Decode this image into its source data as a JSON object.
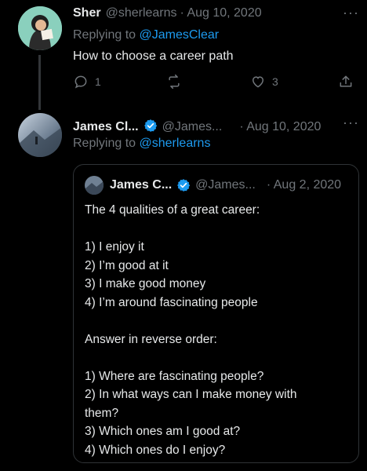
{
  "tweet1": {
    "name": "Sher",
    "handle": "@sherlearns",
    "date": "· Aug 10, 2020",
    "reply_prefix": "Replying to ",
    "reply_to": "@JamesClear",
    "text": "How to choose a career path",
    "reply_count": "1",
    "like_count": "3"
  },
  "tweet2": {
    "name": "James Cl...",
    "handle": "@James...",
    "date": "· Aug 10, 2020",
    "reply_prefix": "Replying to ",
    "reply_to": "@sherlearns"
  },
  "quote": {
    "name": "James C...",
    "handle": "@James...",
    "date": "· Aug 2, 2020",
    "lines": [
      "The 4 qualities of a great career:",
      "",
      "1) I enjoy it",
      "2) I’m good at it",
      "3) I make good money",
      "4) I’m around fascinating people",
      "",
      "Answer in reverse order:",
      "",
      "1) Where are fascinating people?",
      "2) In what ways can I make money with",
      "them?",
      "3) Which ones am I good at?",
      "4) Which ones do I enjoy?"
    ]
  },
  "colors": {
    "background": "#000000",
    "text": "#e7e9ea",
    "muted": "#71767b",
    "link": "#1d9bf0",
    "verified": "#1d9bf0",
    "border": "#2f3336"
  },
  "icons": [
    "reply-icon",
    "retweet-icon",
    "like-icon",
    "share-icon",
    "more-icon",
    "verified-badge-icon"
  ]
}
